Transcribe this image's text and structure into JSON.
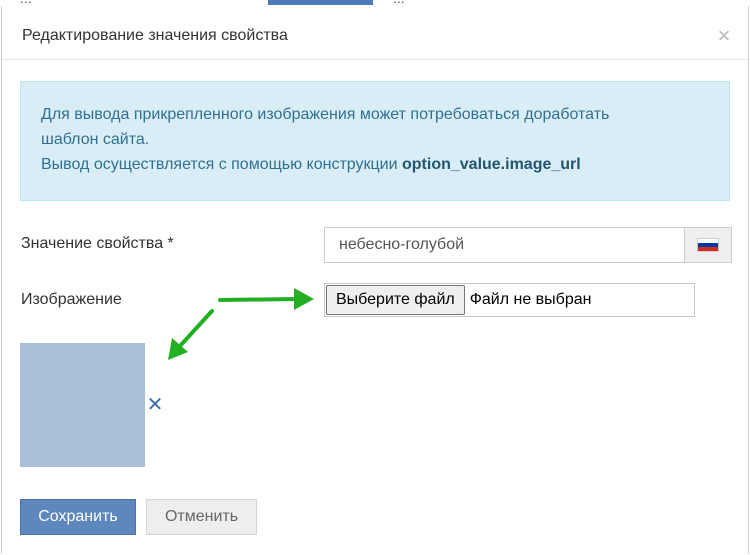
{
  "background": {
    "left_text": "...",
    "right_text": "..."
  },
  "dialog": {
    "title": "Редактирование значения свойства",
    "close_glyph": "×"
  },
  "alert": {
    "line1": "Для вывода прикрепленного изображения может потребоваться доработать",
    "line2": "шаблон сайта.",
    "line3_prefix": "Вывод осуществляется с помощью конструкции",
    "line3_code": "option_value.image_url"
  },
  "form": {
    "value_label": "Значение свойства *",
    "value_input": "небесно-голубой",
    "language_flag": "flag-ru-icon",
    "image_label": "Изображение",
    "file_button": "Выберите файл",
    "file_status": "Файл не выбран",
    "remove_glyph": "✕"
  },
  "buttons": {
    "save": "Сохранить",
    "cancel": "Отменить"
  },
  "colors": {
    "alert_bg": "#d9edf7",
    "alert_text": "#31708f",
    "primary": "#5d87bd",
    "thumbnail": "#a8c0d8",
    "annotation_arrow": "#22b022"
  },
  "flag_colors": [
    "#ffffff",
    "#0039a6",
    "#d52b1e"
  ]
}
